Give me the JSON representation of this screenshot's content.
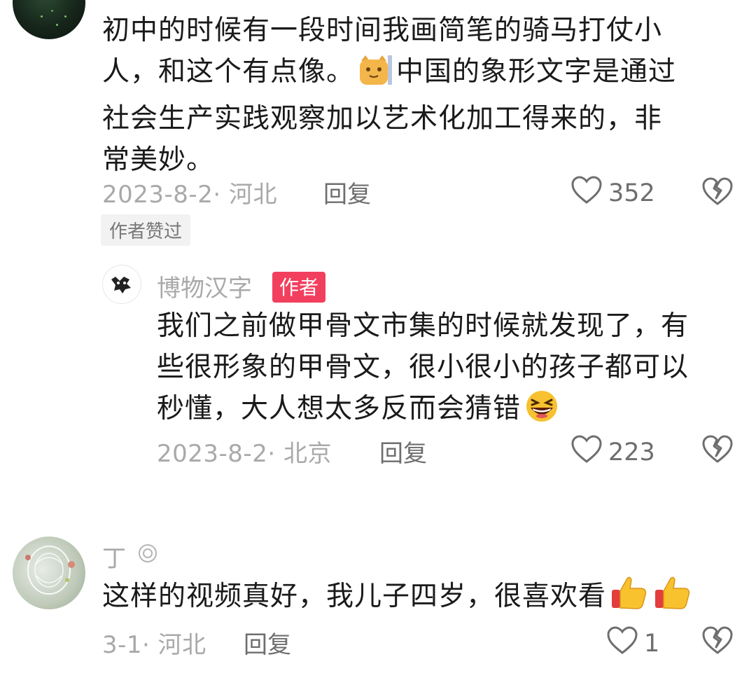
{
  "comment1": {
    "line1": "初中的时候有一段时间我画简笔的骑马打仗小",
    "line2_a": "人，和这个有点像。",
    "line2_b": "中国的象形文字是通过",
    "line3": "社会生产实践观察加以艺术化加工得来的，非",
    "line4": "常美妙。",
    "meta": "2023-8-2· 河北",
    "reply_label": "回复",
    "likes": "352",
    "author_liked_badge": "作者赞过",
    "emoji": "cat-emoji"
  },
  "reply1": {
    "user_name": "博物汉字",
    "author_badge": "作者",
    "line1": "我们之前做甲骨文市集的时候就发现了，有",
    "line2": "些很形象的甲骨文，很小很小的孩子都可以",
    "line3": "秒懂，大人想太多反而会猜错",
    "meta": "2023-8-2· 北京",
    "reply_label": "回复",
    "likes": "223",
    "emoji": "laughing-emoji"
  },
  "comment2": {
    "user_name": "丁",
    "text": "这样的视频真好，我儿子四岁，很喜欢看",
    "meta": "3-1· 河北",
    "reply_label": "回复",
    "likes": "1",
    "emojis": [
      "thumbs-up-emoji",
      "thumbs-up-emoji"
    ]
  },
  "colors": {
    "text": "#1a1a1a",
    "meta": "#a9a9a9",
    "action": "#6e6e6e",
    "author_badge": "#f23f5e"
  }
}
